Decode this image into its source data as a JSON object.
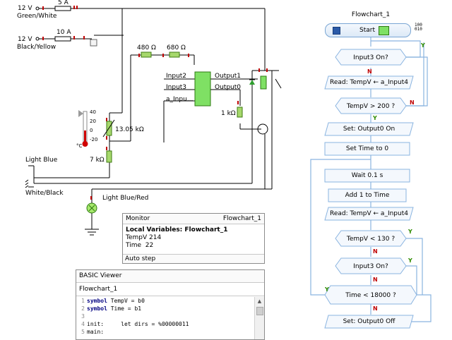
{
  "circuit": {
    "supply1_voltage": "12 V",
    "supply1_wire": "Green/White",
    "fuse1_label": "5 A",
    "supply2_voltage": "12 V",
    "supply2_wire": "Black/Yellow",
    "fuse2_label": "10 A",
    "resistor_480": "480 Ω",
    "resistor_680": "680 Ω",
    "chip_pins": [
      "Input2",
      "Input3",
      "a_Inpu..."
    ],
    "chip_outputs": [
      "Output1",
      "Output0"
    ],
    "resistor_1k": "1 kΩ",
    "sensor_scale": [
      "40",
      "20",
      "0",
      "-20",
      "-20"
    ],
    "sensor_unit": "°C",
    "thermistor_value": "13.05 kΩ",
    "resistor_7k": "7 kΩ",
    "wire_light_blue": "Light Blue",
    "wire_white_black": "White/Black",
    "wire_light_blue_red": "Light Blue/Red"
  },
  "monitor": {
    "title": "Monitor",
    "flowchart_name": "Flowchart_1",
    "locals_heading": "Local Variables: Flowchart_1",
    "vars": [
      "TempV 214",
      "Time  22"
    ],
    "footer": "Auto step"
  },
  "basic": {
    "title": "BASIC Viewer",
    "flowchart_name": "Flowchart_1",
    "lines": [
      {
        "n": "1",
        "kw": "symbol",
        "rest": " TempV = b0"
      },
      {
        "n": "2",
        "kw": "symbol",
        "rest": " Time = b1"
      },
      {
        "n": "3",
        "kw": "",
        "rest": ""
      },
      {
        "n": "4",
        "kw": "",
        "rest": "init:     let dirs = %00000011"
      },
      {
        "n": "5",
        "kw": "",
        "rest": "main:"
      }
    ]
  },
  "flowchart": {
    "title": "Flowchart_1",
    "start": "Start",
    "blocks": {
      "input3_on_1": "Input3       On?",
      "read_1": "Read: TempV ← a_Input4",
      "tempv_gt_200": "TempV    > 200     ?",
      "set_on": "Set: Output0 On",
      "set_time": "Set  Time  to  0",
      "wait": "Wait  0.1 s",
      "add_time": "Add  1  to  Time",
      "read_2": "Read: TempV ← a_Input4",
      "tempv_lt_130": "TempV    < 130     ?",
      "input3_on_2": "Input3       On?",
      "time_lt_18000": "Time   < 18000    ?",
      "set_off": "Set: Output0 Off"
    },
    "yes": "Y",
    "no": "N",
    "accent_color": "#5fa8e8"
  }
}
